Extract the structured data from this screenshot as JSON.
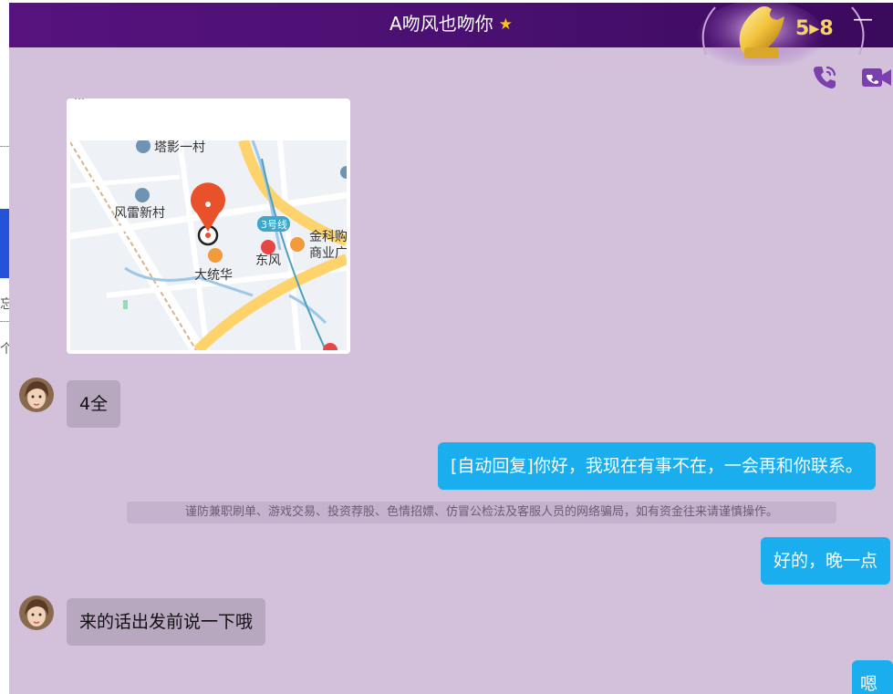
{
  "window": {
    "title": "A吻风也吻你",
    "title_icon": "star-icon",
    "badge_text": "5▸8",
    "minimize_label": "—"
  },
  "toolbar": {
    "call_icon": "phone-icon",
    "video_icon": "video-camera-icon"
  },
  "map": {
    "address_partial": "…",
    "labels": {
      "tayingyicun": "塔影一村",
      "fengleixincun": "风雷新村",
      "line3": "3号线",
      "jinke": "金科购",
      "shangye": "商业广",
      "dongfeng": "东风",
      "datonghua": "大统华"
    }
  },
  "messages": [
    {
      "side": "left",
      "text": "4全"
    },
    {
      "side": "right",
      "text": "[自动回复]你好，我现在有事不在，一会再和你联系。"
    },
    {
      "side": "notice",
      "text": "谨防兼职刷单、游戏交易、投资荐股、色情招嫖、仿冒公检法及客服人员的网络骗局，如有资金往来请谨慎操作。"
    },
    {
      "side": "right",
      "text": "好的，晚一点"
    },
    {
      "side": "left",
      "text": "来的话出发前说一下哦"
    },
    {
      "side": "right",
      "text": "嗯"
    }
  ],
  "left_strip": {
    "char1": "忘",
    "char2": "个"
  },
  "colors": {
    "titlebar": "#4a1070",
    "chat_bg": "#d3c1dc",
    "bubble_right": "#1aaeee",
    "bubble_left": "#b7a7bf",
    "accent_icon": "#7b3fae"
  }
}
